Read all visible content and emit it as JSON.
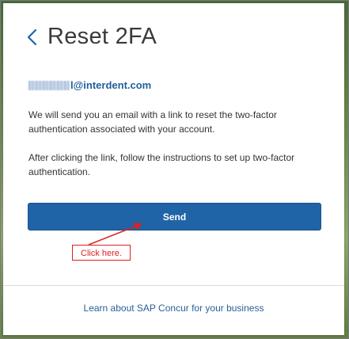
{
  "header": {
    "title": "Reset 2FA"
  },
  "account": {
    "email_suffix": "l@interdent.com"
  },
  "body": {
    "paragraph1": "We will send you an email with a link to reset the two-factor authentication associated with your account.",
    "paragraph2": "After clicking the link, follow the instructions to set up two-factor authentication."
  },
  "actions": {
    "send_label": "Send"
  },
  "annotation": {
    "callout_text": "Click here.",
    "color": "#e02020"
  },
  "footer": {
    "link_text": "Learn about SAP Concur for your business"
  },
  "colors": {
    "primary": "#1f64a6",
    "link": "#2a5f96",
    "email": "#1f5f99"
  },
  "icons": {
    "back": "chevron-left-icon",
    "arrow": "arrow-icon"
  }
}
